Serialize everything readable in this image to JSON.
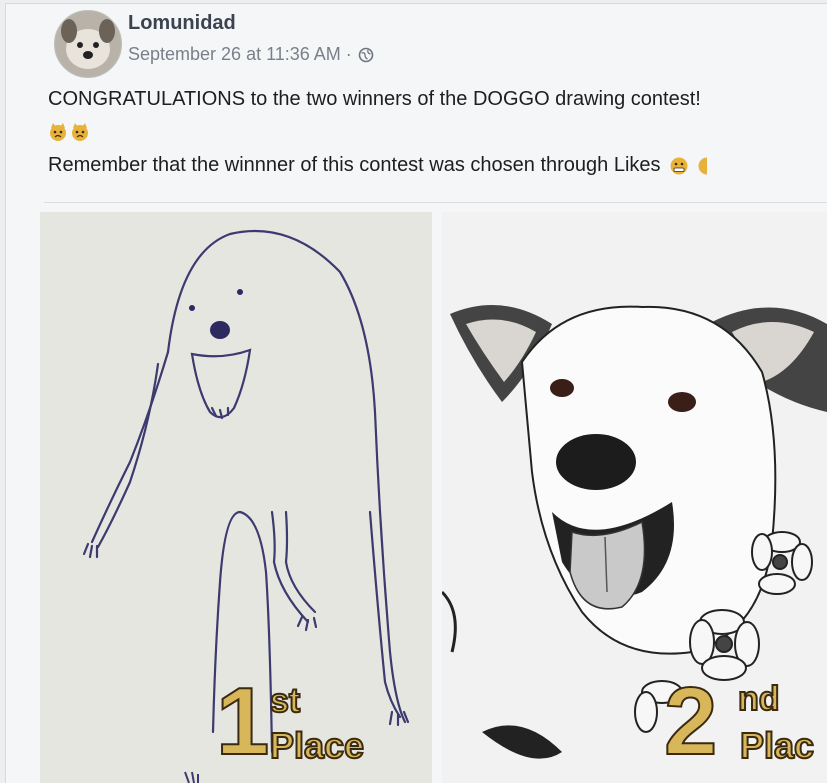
{
  "post": {
    "author": "Lomunidad",
    "timestamp": "September 26 at 11:36 AM ·",
    "privacy_icon": "globe-icon",
    "line1": "CONGRATULATIONS to the two winners of the DOGGO drawing contest!",
    "line2": "Remember that the winnner of this contest was chosen through Likes"
  },
  "images": {
    "first": {
      "number": "1",
      "suffix": "st",
      "word": "Place"
    },
    "second": {
      "number": "2",
      "suffix": "nd",
      "word": "Plac"
    }
  },
  "colors": {
    "accent_gold": "#d8b65a",
    "text_primary": "#1c1e21",
    "text_secondary": "#7a808a"
  }
}
